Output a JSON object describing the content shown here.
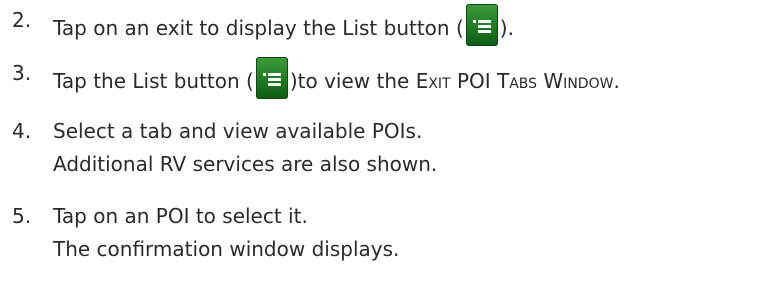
{
  "steps": [
    {
      "number": "2.",
      "text_before": "Tap on an exit to display the List button (",
      "text_after": ")."
    },
    {
      "number": "3.",
      "text_before": "Tap the List button (",
      "text_mid": ")to view the ",
      "window_name": "Exit POI Tabs Window",
      "text_after": "."
    },
    {
      "number": "4.",
      "line1": "Select a tab and view available POIs.",
      "line2": "Additional RV services are also shown."
    },
    {
      "number": "5.",
      "line1": "Tap on an POI to select it.",
      "line2": "The confirmation window displays."
    }
  ],
  "icons": {
    "list_button_icon": "list-icon",
    "icon_color": "#1f7a22"
  }
}
